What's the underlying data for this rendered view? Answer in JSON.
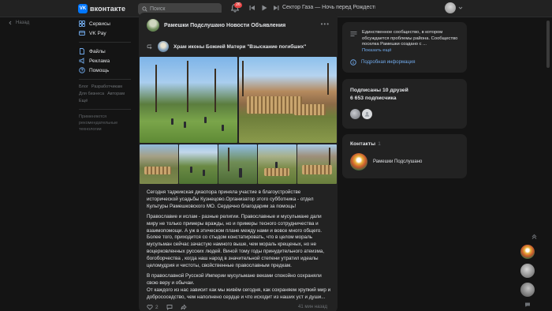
{
  "topbar": {
    "logo_mark": "VK",
    "logo_text": "вконтакте",
    "search_placeholder": "Поиск",
    "notifications_count": "26",
    "now_playing": "Сектор Газа — Ночь перед Рождеств..."
  },
  "left_nav": {
    "back_label": "Назад",
    "items_top": [
      {
        "label": "Сервисы",
        "icon": "services-icon"
      },
      {
        "label": "VK Pay",
        "icon": "vkpay-icon"
      }
    ],
    "items_mid": [
      {
        "label": "Файлы",
        "icon": "files-icon"
      },
      {
        "label": "Реклама",
        "icon": "ads-icon"
      },
      {
        "label": "Помощь",
        "icon": "help-icon"
      }
    ],
    "footer_links": [
      "Блог",
      "Разработчикам",
      "Для бизнеса",
      "Авторам",
      "Ещё"
    ],
    "footer_note": "Применяются рекомендательные технологии"
  },
  "post": {
    "group_name": "Рамешки Подслушано Новости Объявления",
    "repost_name": "Храм иконы Божией Матери \"Взыскание погибших\"",
    "paragraphs": [
      "Сегодня таджикская диаспора приняла участие в благоустройстве исторической усадьбы Кузнецово.Организатор этого субботника - отдел Культуры Рамешковского МО. Сердечно благодарим за помощь!",
      "Православие и ислам - разные религии. Православные и мусульмане дали миру не только примеры вражды, но и примеры тесного сотрудничества и взаимопомощи. А уж в этическом плане между нами и вовсе много общего. Более того, приходится со стыдом констатировать, что в целом мораль мусульман сейчас зачастую намного выше, чем мораль крещеных, но не воцерковленных русских людей. Виной тому годы принудительного атеизма, богоборчества , когда наш народ в значительной степени утратил идеалы целомудрия и чистоты, свойственные православным предкам.",
      "В православной Русской Империи мусульмане веками спокойно сохраняли свою веру и обычаи.",
      "От каждого из нас зависит как мы живём сегодня, как сохраняем хрупкий мир и добрососедство, чем наполнено сердце и что исходит из наших уст и души..."
    ],
    "likes": "2",
    "time": "41 мин назад"
  },
  "right": {
    "info_text": "Единственное сообщество, в котором обсуждается проблемы района. Сообщество поселка Рамешки создано с ...",
    "info_more": "Показать ещё",
    "detail_link": "Подробная информация",
    "friends_line": "Подписаны 10 друзей",
    "subscribers_line": "6 653 подписчика",
    "contacts_title": "Контакты",
    "contacts_count": "1",
    "contact_name": "Рамешки Подслушано"
  },
  "colors": {
    "accent": "#0077ff",
    "link": "#71aaeb",
    "badge": "#e64646",
    "card": "#222222",
    "bg": "#141414"
  }
}
